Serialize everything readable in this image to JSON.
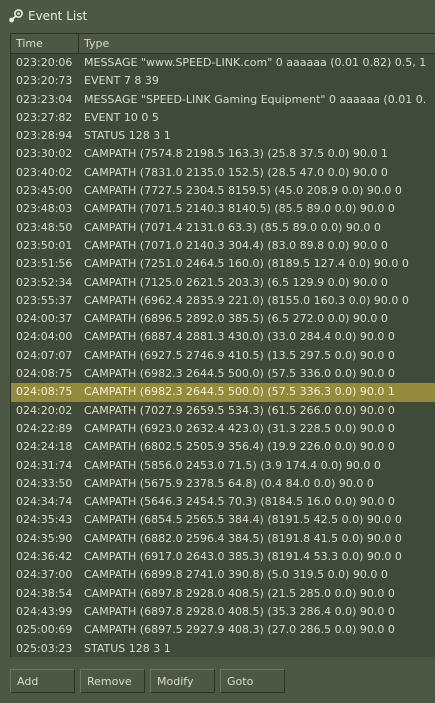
{
  "window": {
    "title": "Event List",
    "icon": "steam-icon"
  },
  "columns": {
    "time": "Time",
    "type": "Type"
  },
  "rows": [
    {
      "time": "023:20:06",
      "type": "MESSAGE \"www.SPEED-LINK.com\" 0 aaaaaa (0.01 0.82) 0.5, 1"
    },
    {
      "time": "023:20:73",
      "type": "EVENT 7 8 39"
    },
    {
      "time": "023:23:04",
      "type": "MESSAGE \"SPEED-LINK Gaming Equipment\" 0 aaaaaa (0.01 0."
    },
    {
      "time": "023:27:82",
      "type": "EVENT 10 0 5"
    },
    {
      "time": "023:28:94",
      "type": "STATUS 128 3 1"
    },
    {
      "time": "023:30:02",
      "type": "CAMPATH (7574.8 2198.5 163.3) (25.8 37.5 0.0) 90.0 1"
    },
    {
      "time": "023:40:02",
      "type": "CAMPATH (7831.0 2135.0 152.5) (28.5 47.0 0.0) 90.0 0"
    },
    {
      "time": "023:45:00",
      "type": "CAMPATH (7727.5 2304.5 8159.5) (45.0 208.9 0.0) 90.0 0"
    },
    {
      "time": "023:48:03",
      "type": "CAMPATH (7071.5 2140.3 8140.5) (85.5 89.0 0.0) 90.0 0"
    },
    {
      "time": "023:48:50",
      "type": "CAMPATH (7071.4 2131.0 63.3) (85.5 89.0 0.0) 90.0 0"
    },
    {
      "time": "023:50:01",
      "type": "CAMPATH (7071.0 2140.3 304.4) (83.0 89.8 0.0) 90.0 0"
    },
    {
      "time": "023:51:56",
      "type": "CAMPATH (7251.0 2464.5 160.0) (8189.5 127.4 0.0) 90.0 0"
    },
    {
      "time": "023:52:34",
      "type": "CAMPATH (7125.0 2621.5 203.3) (6.5 129.9 0.0) 90.0 0"
    },
    {
      "time": "023:55:37",
      "type": "CAMPATH (6962.4 2835.9 221.0) (8155.0 160.3 0.0) 90.0 0"
    },
    {
      "time": "024:00:37",
      "type": "CAMPATH (6896.5 2892.0 385.5) (6.5 272.0 0.0) 90.0 0"
    },
    {
      "time": "024:04:00",
      "type": "CAMPATH (6887.4 2881.3 430.0) (33.0 284.4 0.0) 90.0 0"
    },
    {
      "time": "024:07:07",
      "type": "CAMPATH (6927.5 2746.9 410.5) (13.5 297.5 0.0) 90.0 0"
    },
    {
      "time": "024:08:75",
      "type": "CAMPATH (6982.3 2644.5 500.0) (57.5 336.0 0.0) 90.0 0"
    },
    {
      "time": "024:08:75",
      "type": "CAMPATH (6982.3 2644.5 500.0) (57.5 336.3 0.0) 90.0 1",
      "selected": true
    },
    {
      "time": "024:20:02",
      "type": "CAMPATH (7027.9 2659.5 534.3) (61.5 266.0 0.0) 90.0 0"
    },
    {
      "time": "024:22:89",
      "type": "CAMPATH (6923.0 2632.4 423.0) (31.3 228.5 0.0) 90.0 0"
    },
    {
      "time": "024:24:18",
      "type": "CAMPATH (6802.5 2505.9 356.4) (19.9 226.0 0.0) 90.0 0"
    },
    {
      "time": "024:31:74",
      "type": "CAMPATH (5856.0 2453.0 71.5) (3.9 174.4 0.0) 90.0 0"
    },
    {
      "time": "024:33:50",
      "type": "CAMPATH (5675.9 2378.5 64.8) (0.4 84.0 0.0) 90.0 0"
    },
    {
      "time": "024:34:74",
      "type": "CAMPATH (5646.3 2454.5 70.3) (8184.5 16.0 0.0) 90.0 0"
    },
    {
      "time": "024:35:43",
      "type": "CAMPATH (6854.5 2565.5 384.4) (8191.5 42.5 0.0) 90.0 0"
    },
    {
      "time": "024:35:90",
      "type": "CAMPATH (6882.0 2596.4 384.5) (8191.8 41.5 0.0) 90.0 0"
    },
    {
      "time": "024:36:42",
      "type": "CAMPATH (6917.0 2643.0 385.3) (8191.4 53.3 0.0) 90.0 0"
    },
    {
      "time": "024:37:00",
      "type": "CAMPATH (6899.8 2741.0 390.8) (5.0 319.5 0.0) 90.0 0"
    },
    {
      "time": "024:38:54",
      "type": "CAMPATH (6897.8 2928.0 408.5) (21.5 285.0 0.0) 90.0 0"
    },
    {
      "time": "024:43:99",
      "type": "CAMPATH (6897.8 2928.0 408.5) (35.3 286.4 0.0) 90.0 0"
    },
    {
      "time": "025:00:69",
      "type": "CAMPATH (6897.5 2927.9 408.3) (27.0 286.5 0.0) 90.0 0"
    },
    {
      "time": "025:03:23",
      "type": "STATUS 128 3 1"
    }
  ],
  "buttons": {
    "add": "Add",
    "remove": "Remove",
    "modify": "Modify",
    "goto": "Goto"
  }
}
